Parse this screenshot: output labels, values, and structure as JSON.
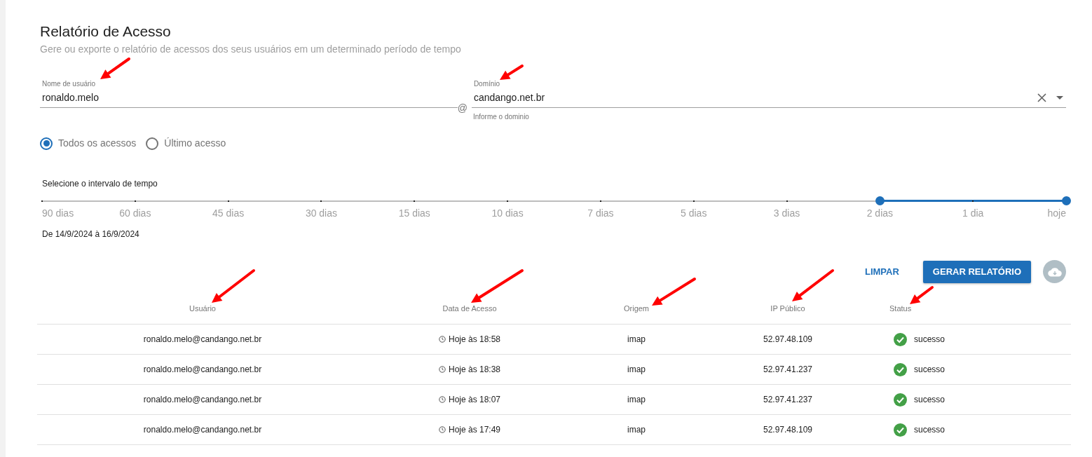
{
  "header": {
    "title": "Relatório de Acesso",
    "subtitle": "Gere ou exporte o relatório de acessos dos seus usuários em um determinado período de tempo"
  },
  "username_field": {
    "label": "Nome de usuário",
    "value": "ronaldo.melo",
    "suffix": "@"
  },
  "domain_field": {
    "label": "Domínio",
    "value": "candango.net.br",
    "hint": "Informe o dominio"
  },
  "radios": [
    {
      "label": "Todos os acessos",
      "selected": true
    },
    {
      "label": "Último acesso",
      "selected": false
    }
  ],
  "time_range": {
    "label": "Selecione o intervalo de tempo",
    "stops": [
      {
        "label": "90 dias",
        "in_range": false
      },
      {
        "label": "60 dias",
        "in_range": false
      },
      {
        "label": "45 dias",
        "in_range": false
      },
      {
        "label": "30 dias",
        "in_range": false
      },
      {
        "label": "15 dias",
        "in_range": false
      },
      {
        "label": "10 dias",
        "in_range": false
      },
      {
        "label": "7 dias",
        "in_range": false
      },
      {
        "label": "5 dias",
        "in_range": false
      },
      {
        "label": "3 dias",
        "in_range": false
      },
      {
        "label": "2 dias",
        "in_range": true
      },
      {
        "label": "1 dia",
        "in_range": true
      },
      {
        "label": "hoje",
        "in_range": true
      }
    ],
    "period": "De 14/9/2024 à 16/9/2024"
  },
  "actions": {
    "clear": "LIMPAR",
    "generate": "GERAR RELATÓRIO"
  },
  "table": {
    "columns": [
      "Usuário",
      "Data de Acesso",
      "Origem",
      "IP Público",
      "Status"
    ],
    "rows": [
      {
        "user": "ronaldo.melo@candango.net.br",
        "date": "Hoje às 18:58",
        "origin": "imap",
        "ip": "52.97.48.109",
        "status": "sucesso",
        "kind": "success"
      },
      {
        "user": "ronaldo.melo@candango.net.br",
        "date": "Hoje às 18:38",
        "origin": "imap",
        "ip": "52.97.41.237",
        "status": "sucesso",
        "kind": "success"
      },
      {
        "user": "ronaldo.melo@candango.net.br",
        "date": "Hoje às 18:07",
        "origin": "imap",
        "ip": "52.97.41.237",
        "status": "sucesso",
        "kind": "success"
      },
      {
        "user": "ronaldo.melo@candango.net.br",
        "date": "Hoje às 17:49",
        "origin": "imap",
        "ip": "52.97.48.109",
        "status": "sucesso",
        "kind": "success"
      }
    ]
  }
}
